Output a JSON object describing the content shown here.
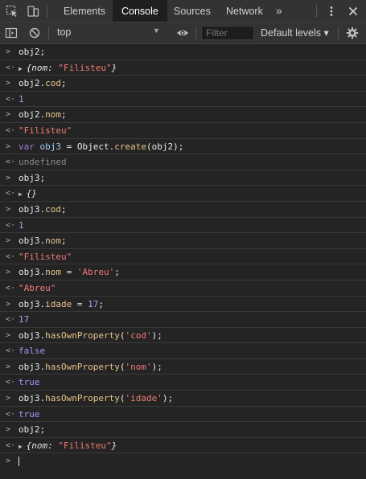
{
  "tabs": [
    {
      "label": "Elements",
      "active": false
    },
    {
      "label": "Console",
      "active": true
    },
    {
      "label": "Sources",
      "active": false
    },
    {
      "label": "Network",
      "active": false
    }
  ],
  "toolbar": {
    "context": "top",
    "filter_placeholder": "Filter",
    "levels_label": "Default levels ▾"
  },
  "console": {
    "prompt_symbol": ">",
    "result_symbol": "<·",
    "lines": [
      {
        "kind": "input",
        "segments": [
          {
            "t": "obj2;",
            "c": "id"
          }
        ]
      },
      {
        "kind": "output",
        "expandable": true,
        "segments": [
          {
            "t": "{nom: ",
            "c": "obj"
          },
          {
            "t": "\"Filisteu\"",
            "c": "str"
          },
          {
            "t": "}",
            "c": "obj"
          }
        ]
      },
      {
        "kind": "input",
        "segments": [
          {
            "t": "obj2.",
            "c": "id"
          },
          {
            "t": "cod",
            "c": "prop"
          },
          {
            "t": ";",
            "c": "id"
          }
        ]
      },
      {
        "kind": "output",
        "segments": [
          {
            "t": "1",
            "c": "num"
          }
        ]
      },
      {
        "kind": "input",
        "segments": [
          {
            "t": "obj2.",
            "c": "id"
          },
          {
            "t": "nom",
            "c": "prop"
          },
          {
            "t": ";",
            "c": "id"
          }
        ]
      },
      {
        "kind": "output",
        "segments": [
          {
            "t": "\"Filisteu\"",
            "c": "str"
          }
        ]
      },
      {
        "kind": "input",
        "segments": [
          {
            "t": "var ",
            "c": "kw"
          },
          {
            "t": "obj3",
            "c": "var"
          },
          {
            "t": " = Object.",
            "c": "id"
          },
          {
            "t": "create",
            "c": "prop"
          },
          {
            "t": "(obj2);",
            "c": "id"
          }
        ]
      },
      {
        "kind": "output",
        "segments": [
          {
            "t": "undefined",
            "c": "undef"
          }
        ]
      },
      {
        "kind": "input",
        "segments": [
          {
            "t": "obj3;",
            "c": "id"
          }
        ]
      },
      {
        "kind": "output",
        "expandable": true,
        "segments": [
          {
            "t": "{}",
            "c": "obj"
          }
        ]
      },
      {
        "kind": "input",
        "segments": [
          {
            "t": "obj3.",
            "c": "id"
          },
          {
            "t": "cod",
            "c": "prop"
          },
          {
            "t": ";",
            "c": "id"
          }
        ]
      },
      {
        "kind": "output",
        "segments": [
          {
            "t": "1",
            "c": "num"
          }
        ]
      },
      {
        "kind": "input",
        "segments": [
          {
            "t": "obj3.",
            "c": "id"
          },
          {
            "t": "nom",
            "c": "prop"
          },
          {
            "t": ";",
            "c": "id"
          }
        ]
      },
      {
        "kind": "output",
        "segments": [
          {
            "t": "\"Filisteu\"",
            "c": "str"
          }
        ]
      },
      {
        "kind": "input",
        "segments": [
          {
            "t": "obj3.",
            "c": "id"
          },
          {
            "t": "nom",
            "c": "prop"
          },
          {
            "t": " = ",
            "c": "id"
          },
          {
            "t": "'Abreu'",
            "c": "str"
          },
          {
            "t": ";",
            "c": "id"
          }
        ]
      },
      {
        "kind": "output",
        "segments": [
          {
            "t": "\"Abreu\"",
            "c": "str"
          }
        ]
      },
      {
        "kind": "input",
        "segments": [
          {
            "t": "obj3.",
            "c": "id"
          },
          {
            "t": "idade",
            "c": "prop"
          },
          {
            "t": " = ",
            "c": "id"
          },
          {
            "t": "17",
            "c": "num"
          },
          {
            "t": ";",
            "c": "id"
          }
        ]
      },
      {
        "kind": "output",
        "segments": [
          {
            "t": "17",
            "c": "num"
          }
        ]
      },
      {
        "kind": "input",
        "segments": [
          {
            "t": "obj3.",
            "c": "id"
          },
          {
            "t": "hasOwnProperty",
            "c": "prop"
          },
          {
            "t": "(",
            "c": "id"
          },
          {
            "t": "'cod'",
            "c": "str"
          },
          {
            "t": ");",
            "c": "id"
          }
        ]
      },
      {
        "kind": "output",
        "segments": [
          {
            "t": "false",
            "c": "bool"
          }
        ]
      },
      {
        "kind": "input",
        "segments": [
          {
            "t": "obj3.",
            "c": "id"
          },
          {
            "t": "hasOwnProperty",
            "c": "prop"
          },
          {
            "t": "(",
            "c": "id"
          },
          {
            "t": "'nom'",
            "c": "str"
          },
          {
            "t": ");",
            "c": "id"
          }
        ]
      },
      {
        "kind": "output",
        "segments": [
          {
            "t": "true",
            "c": "bool"
          }
        ]
      },
      {
        "kind": "input",
        "segments": [
          {
            "t": "obj3.",
            "c": "id"
          },
          {
            "t": "hasOwnProperty",
            "c": "prop"
          },
          {
            "t": "(",
            "c": "id"
          },
          {
            "t": "'idade'",
            "c": "str"
          },
          {
            "t": ");",
            "c": "id"
          }
        ]
      },
      {
        "kind": "output",
        "segments": [
          {
            "t": "true",
            "c": "bool"
          }
        ]
      },
      {
        "kind": "input",
        "segments": [
          {
            "t": "obj2;",
            "c": "id"
          }
        ]
      },
      {
        "kind": "output",
        "expandable": true,
        "segments": [
          {
            "t": "{nom: ",
            "c": "obj"
          },
          {
            "t": "\"Filisteu\"",
            "c": "str"
          },
          {
            "t": "}",
            "c": "obj"
          }
        ]
      }
    ]
  },
  "colors": {
    "background": "#242424",
    "chrome": "#333333",
    "string": "#ef7a74",
    "number": "#9aa7f0",
    "property": "#e9c48a",
    "keyword": "#9a7fd5",
    "prompt": "#4aa3f5"
  }
}
